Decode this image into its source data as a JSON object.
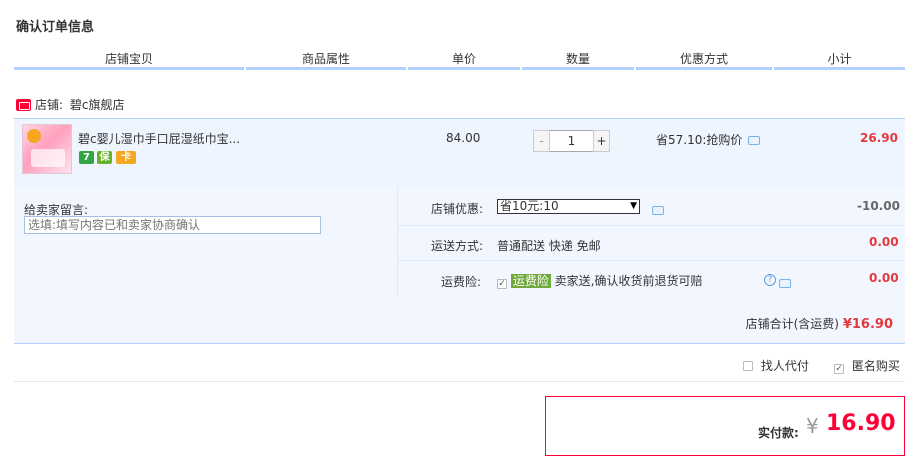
{
  "title": "确认订单信息",
  "headers": [
    "店铺宝贝",
    "商品属性",
    "单价",
    "数量",
    "优惠方式",
    "小计"
  ],
  "shop": {
    "label": "店铺:",
    "name": "碧c旗舰店"
  },
  "item": {
    "name": "碧c婴儿湿巾手口屁湿纸巾宝...",
    "badges": [
      "7",
      "保",
      "卡"
    ],
    "price": "84.00",
    "quantity": "1",
    "qty_minus": "-",
    "qty_plus": "+",
    "promo": "省57.10:抢购价",
    "subtotal": "26.90"
  },
  "note": {
    "label": "给卖家留言:",
    "placeholder": "选填:填写内容已和卖家协商确认"
  },
  "options": {
    "shop_discount_label": "店铺优惠:",
    "shop_discount_select": "省10元:10",
    "shop_discount_amount": "-10.00",
    "shipping_label": "运送方式:",
    "shipping_value": "普通配送 快递 免邮",
    "shipping_amount": "0.00",
    "insurance_label": "运费险:",
    "insurance_tag": "运费险",
    "insurance_text": "卖家送,确认收货前退货可赔",
    "insurance_amount": "0.00"
  },
  "shop_total": {
    "label": "店铺合计(含运费)",
    "amount": "¥16.90"
  },
  "extra": {
    "find_payer": "找人代付",
    "anonymous": "匿名购买"
  },
  "payment": {
    "label": "实付款:",
    "currency": "¥",
    "amount": "16.90"
  },
  "colors": {
    "price_red": "#e4393c",
    "accent_blue": "#b2d1ff",
    "pay_border": "#ff0036"
  }
}
